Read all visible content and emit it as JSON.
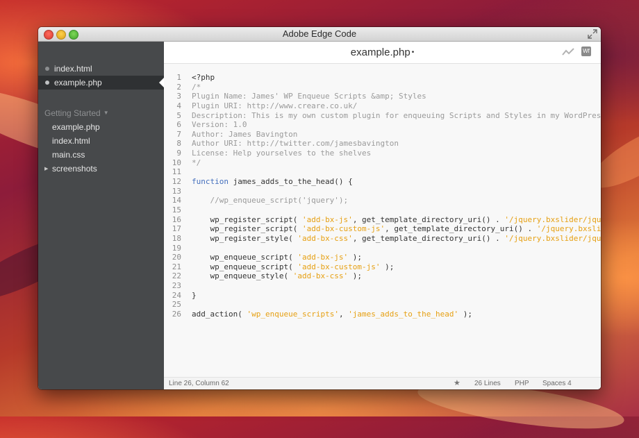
{
  "window": {
    "title": "Adobe Edge Code"
  },
  "sidebar": {
    "working_files": [
      {
        "label": "index.html",
        "selected": false
      },
      {
        "label": "example.php",
        "selected": true
      }
    ],
    "project": {
      "title": "Getting Started",
      "items": [
        {
          "label": "example.php",
          "type": "file"
        },
        {
          "label": "index.html",
          "type": "file"
        },
        {
          "label": "main.css",
          "type": "file"
        },
        {
          "label": "screenshots",
          "type": "folder"
        }
      ]
    }
  },
  "editor": {
    "file_title": "example.php",
    "dirty_marker": "•",
    "toolbar": {
      "live_preview_icon": "live-preview-icon",
      "web_fonts_label": "Wf"
    },
    "lines": [
      {
        "num": "1",
        "tokens": [
          {
            "t": "<?php",
            "k": "plain"
          }
        ]
      },
      {
        "num": "2",
        "tokens": [
          {
            "t": "/*",
            "k": "comment"
          }
        ]
      },
      {
        "num": "3",
        "tokens": [
          {
            "t": "Plugin Name: James' WP Enqueue Scripts &amp; Styles",
            "k": "comment"
          }
        ]
      },
      {
        "num": "4",
        "tokens": [
          {
            "t": "Plugin URI: http://www.creare.co.uk/",
            "k": "comment"
          }
        ]
      },
      {
        "num": "5",
        "tokens": [
          {
            "t": "Description: This is my own custom plugin for enqueuing Scripts and Styles in my WordPress th",
            "k": "comment"
          }
        ]
      },
      {
        "num": "6",
        "tokens": [
          {
            "t": "Version: 1.0",
            "k": "comment"
          }
        ]
      },
      {
        "num": "7",
        "tokens": [
          {
            "t": "Author: James Bavington",
            "k": "comment"
          }
        ]
      },
      {
        "num": "8",
        "tokens": [
          {
            "t": "Author URI: http://twitter.com/jamesbavington",
            "k": "comment"
          }
        ]
      },
      {
        "num": "9",
        "tokens": [
          {
            "t": "License: Help yourselves to the shelves",
            "k": "comment"
          }
        ]
      },
      {
        "num": "10",
        "tokens": [
          {
            "t": "*/",
            "k": "comment"
          }
        ]
      },
      {
        "num": "11",
        "tokens": []
      },
      {
        "num": "12",
        "tokens": [
          {
            "t": "function",
            "k": "keyword"
          },
          {
            "t": " james_adds_to_the_head() {",
            "k": "plain"
          }
        ]
      },
      {
        "num": "13",
        "tokens": []
      },
      {
        "num": "14",
        "tokens": [
          {
            "t": "    //wp_enqueue_script('jquery');",
            "k": "comment"
          }
        ]
      },
      {
        "num": "15",
        "tokens": []
      },
      {
        "num": "16",
        "tokens": [
          {
            "t": "    wp_register_script( ",
            "k": "plain"
          },
          {
            "t": "'add-bx-js'",
            "k": "string"
          },
          {
            "t": ", get_template_directory_uri() . ",
            "k": "plain"
          },
          {
            "t": "'/jquery.bxslider/jquery.",
            "k": "string"
          }
        ]
      },
      {
        "num": "17",
        "tokens": [
          {
            "t": "    wp_register_script( ",
            "k": "plain"
          },
          {
            "t": "'add-bx-custom-js'",
            "k": "string"
          },
          {
            "t": ", get_template_directory_uri() . ",
            "k": "plain"
          },
          {
            "t": "'/jquery.bxslider/",
            "k": "string"
          }
        ]
      },
      {
        "num": "18",
        "tokens": [
          {
            "t": "    wp_register_style( ",
            "k": "plain"
          },
          {
            "t": "'add-bx-css'",
            "k": "string"
          },
          {
            "t": ", get_template_directory_uri() . ",
            "k": "plain"
          },
          {
            "t": "'/jquery.bxslider/jquery.",
            "k": "string"
          }
        ]
      },
      {
        "num": "19",
        "tokens": []
      },
      {
        "num": "20",
        "tokens": [
          {
            "t": "    wp_enqueue_script( ",
            "k": "plain"
          },
          {
            "t": "'add-bx-js'",
            "k": "string"
          },
          {
            "t": " );",
            "k": "plain"
          }
        ]
      },
      {
        "num": "21",
        "tokens": [
          {
            "t": "    wp_enqueue_script( ",
            "k": "plain"
          },
          {
            "t": "'add-bx-custom-js'",
            "k": "string"
          },
          {
            "t": " );",
            "k": "plain"
          }
        ]
      },
      {
        "num": "22",
        "tokens": [
          {
            "t": "    wp_enqueue_style( ",
            "k": "plain"
          },
          {
            "t": "'add-bx-css'",
            "k": "string"
          },
          {
            "t": " );",
            "k": "plain"
          }
        ]
      },
      {
        "num": "23",
        "tokens": []
      },
      {
        "num": "24",
        "tokens": [
          {
            "t": "}",
            "k": "plain"
          }
        ]
      },
      {
        "num": "25",
        "tokens": []
      },
      {
        "num": "26",
        "tokens": [
          {
            "t": "add_action( ",
            "k": "plain"
          },
          {
            "t": "'wp_enqueue_scripts'",
            "k": "string"
          },
          {
            "t": ", ",
            "k": "plain"
          },
          {
            "t": "'james_adds_to_the_head'",
            "k": "string"
          },
          {
            "t": " );",
            "k": "plain"
          }
        ]
      }
    ]
  },
  "statusbar": {
    "cursor": "Line 26, Column 62",
    "star_icon": "★",
    "line_count": "26 Lines",
    "language": "PHP",
    "indent": "Spaces 4"
  },
  "colors": {
    "sidebar_bg": "#47494b",
    "keyword": "#446fbd",
    "string": "#e6a013",
    "comment": "#9a9a9a"
  }
}
